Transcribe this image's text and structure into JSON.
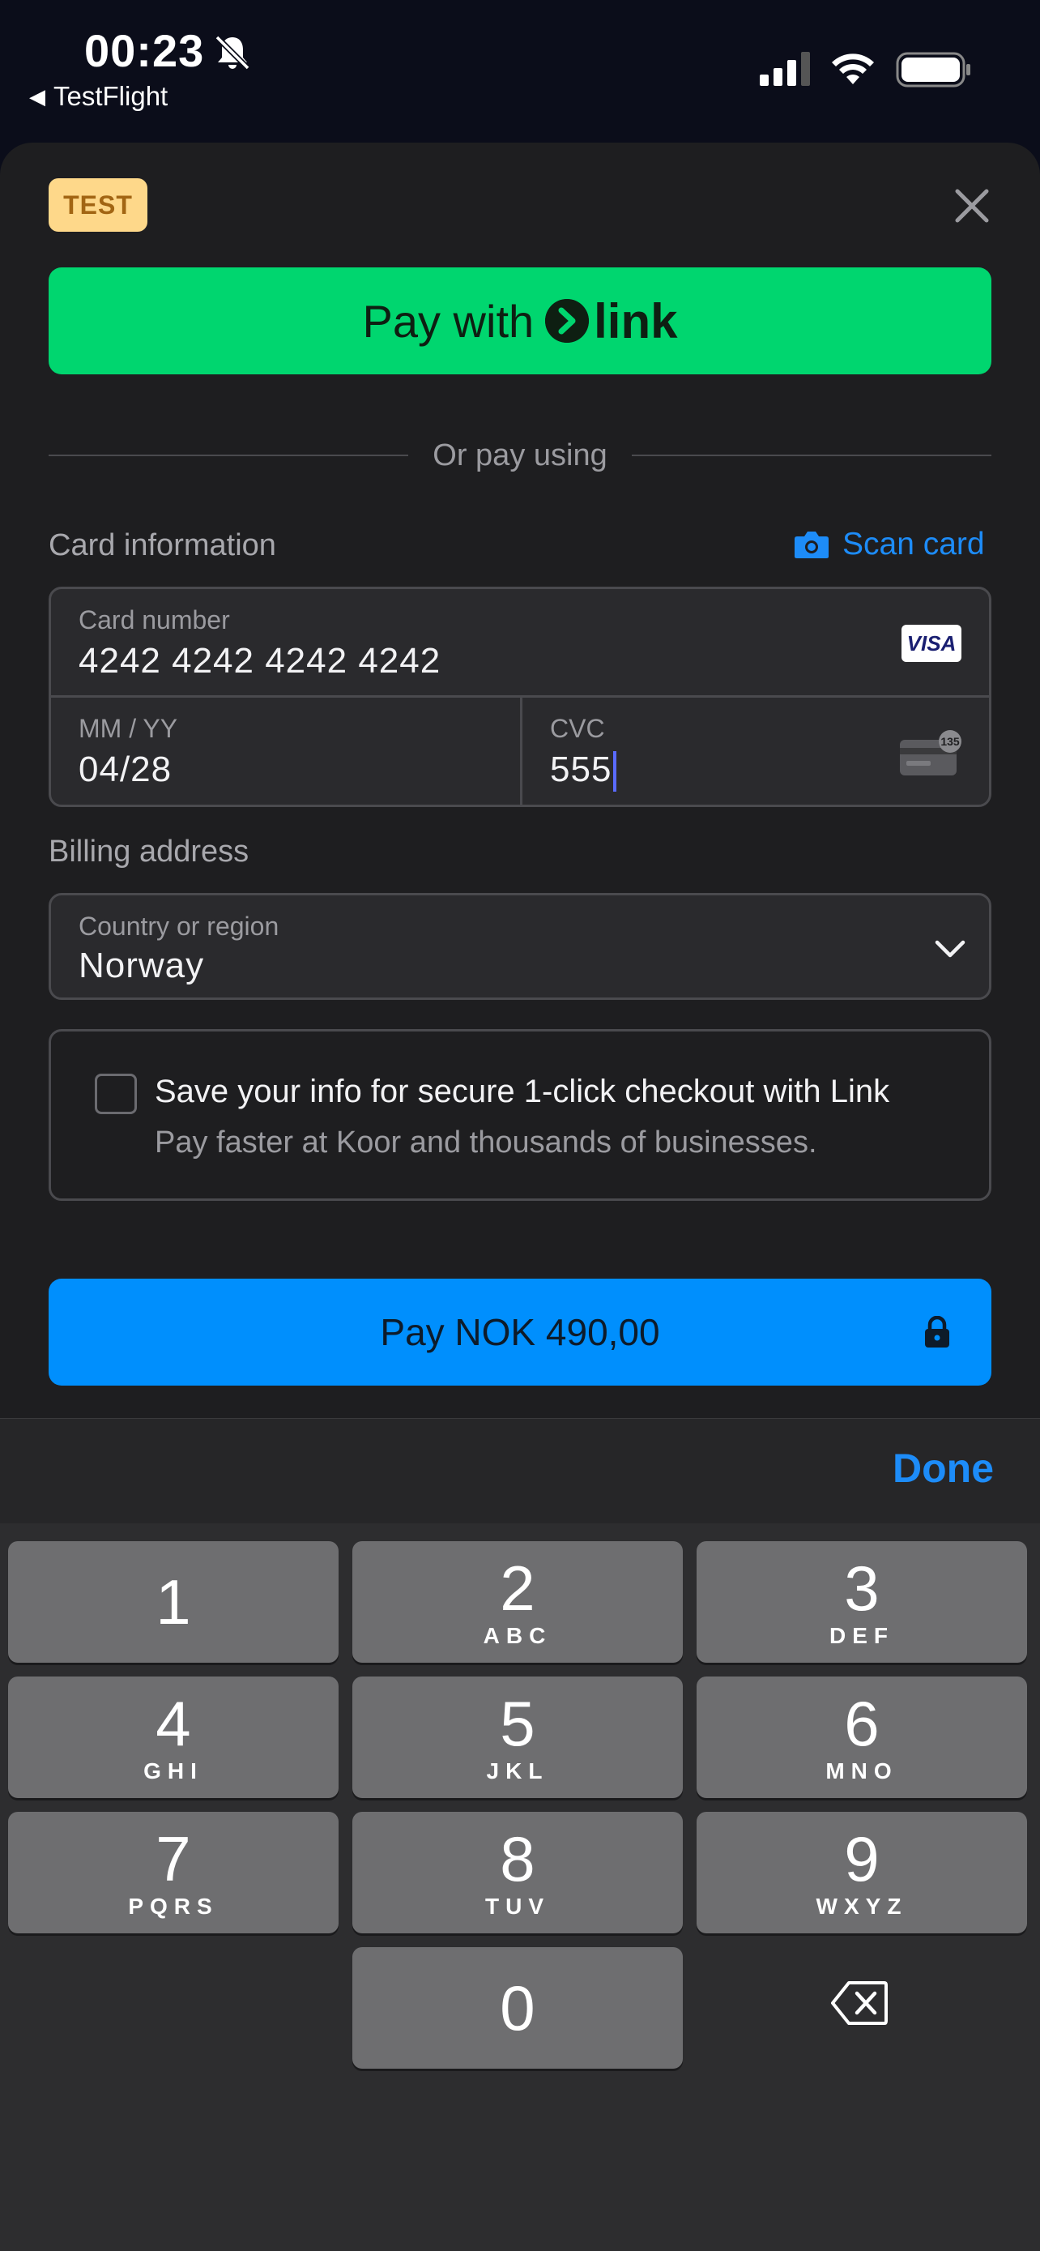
{
  "status_bar": {
    "time": "00:23",
    "back_app": "TestFlight"
  },
  "sheet": {
    "test_badge": "TEST",
    "link_button": {
      "prefix": "Pay with",
      "brand": "link"
    },
    "divider_text": "Or pay using",
    "card_section": {
      "title": "Card information",
      "scan_label": "Scan card",
      "card_number_label": "Card number",
      "card_number_value": "4242 4242 4242 4242",
      "card_brand": "VISA",
      "expiry_label": "MM / YY",
      "expiry_value": "04/28",
      "cvc_label": "CVC",
      "cvc_value": "555",
      "cvc_hint": "135"
    },
    "billing": {
      "title": "Billing address",
      "country_label": "Country or region",
      "country_value": "Norway"
    },
    "save_info": {
      "title": "Save your info for secure 1-click checkout with Link",
      "subtitle": "Pay faster at Koor and thousands of businesses.",
      "checked": false
    },
    "pay_button": "Pay NOK 490,00"
  },
  "keyboard": {
    "done": "Done",
    "keys": [
      {
        "num": "1",
        "letters": ""
      },
      {
        "num": "2",
        "letters": "ABC"
      },
      {
        "num": "3",
        "letters": "DEF"
      },
      {
        "num": "4",
        "letters": "GHI"
      },
      {
        "num": "5",
        "letters": "JKL"
      },
      {
        "num": "6",
        "letters": "MNO"
      },
      {
        "num": "7",
        "letters": "PQRS"
      },
      {
        "num": "8",
        "letters": "TUV"
      },
      {
        "num": "9",
        "letters": "WXYZ"
      },
      {
        "num": "0",
        "letters": ""
      }
    ]
  },
  "colors": {
    "link_green": "#00d66f",
    "pay_blue": "#008ffd",
    "accent_blue": "#1d8cf8",
    "test_badge_bg": "#fed88a"
  }
}
